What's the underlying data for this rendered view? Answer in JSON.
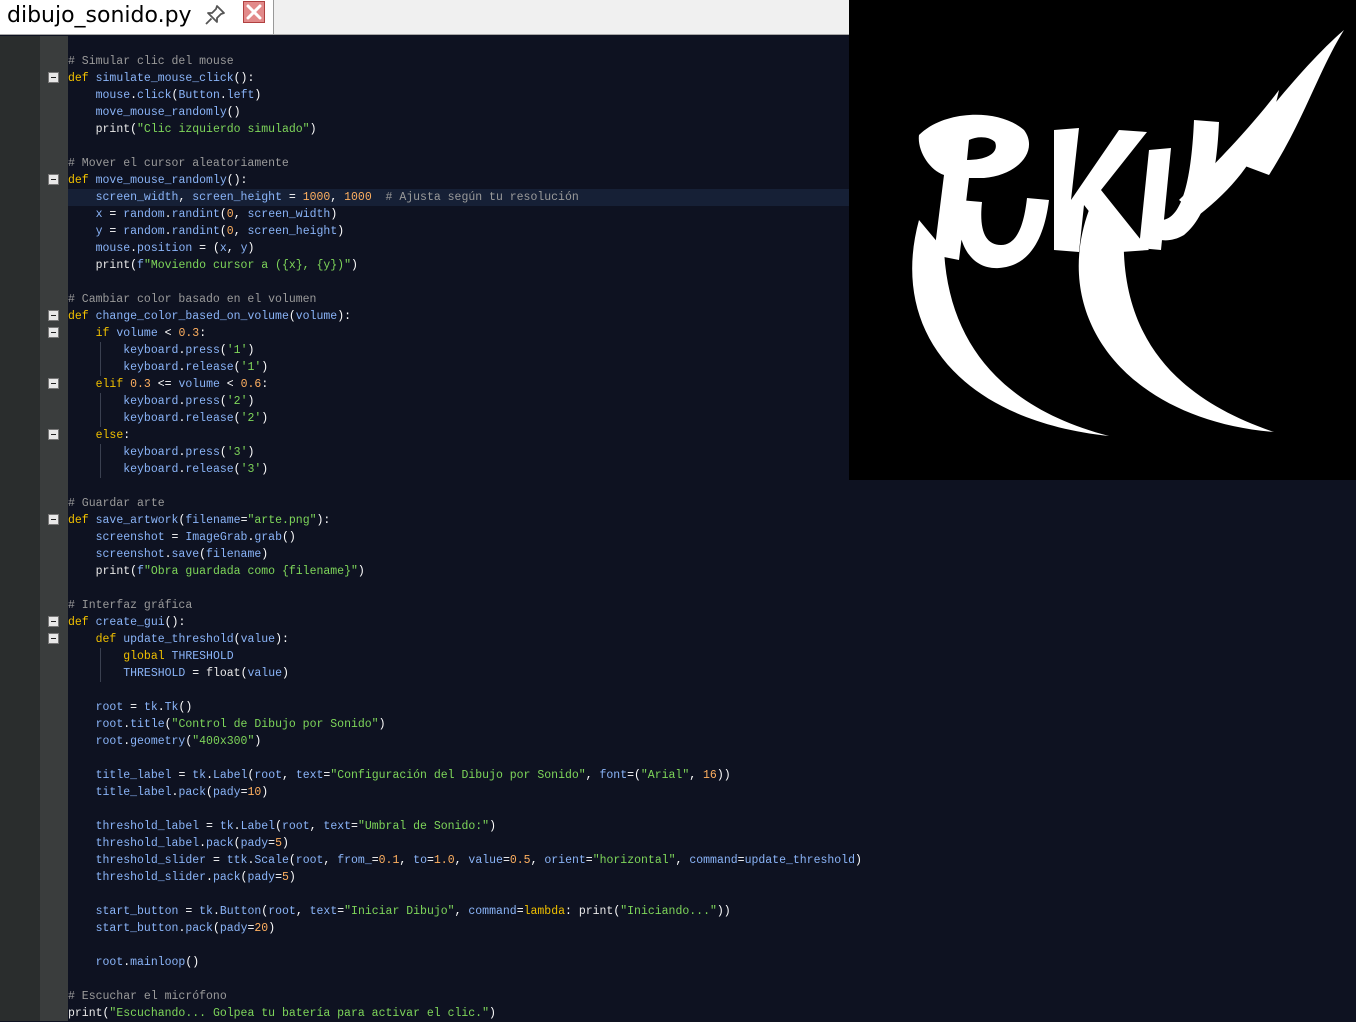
{
  "tab": {
    "filename": "dibujo_sonido.py"
  },
  "icons": {
    "pin": "pin-icon",
    "close": "close-icon"
  },
  "colors": {
    "editor_bg": "#0e1221",
    "comment": "#9a9a9a",
    "keyword": "#f0c000",
    "string": "#7ed65a",
    "number": "#ffb060",
    "variable": "#8ab4f8",
    "close_button": "#e28a8a"
  },
  "code": {
    "lines": [
      "# Simular clic del mouse",
      "def simulate_mouse_click():",
      "    mouse.click(Button.left)",
      "    move_mouse_randomly()",
      "    print(\"Clic izquierdo simulado\")",
      "",
      "# Mover el cursor aleatoriamente",
      "def move_mouse_randomly():",
      "    screen_width, screen_height = 1000, 1000  # Ajusta según tu resolución",
      "    x = random.randint(0, screen_width)",
      "    y = random.randint(0, screen_height)",
      "    mouse.position = (x, y)",
      "    print(f\"Moviendo cursor a ({x}, {y})\")",
      "",
      "# Cambiar color basado en el volumen",
      "def change_color_based_on_volume(volume):",
      "    if volume < 0.3:",
      "        keyboard.press('1')",
      "        keyboard.release('1')",
      "    elif 0.3 <= volume < 0.6:",
      "        keyboard.press('2')",
      "        keyboard.release('2')",
      "    else:",
      "        keyboard.press('3')",
      "        keyboard.release('3')",
      "",
      "# Guardar arte",
      "def save_artwork(filename=\"arte.png\"):",
      "    screenshot = ImageGrab.grab()",
      "    screenshot.save(filename)",
      "    print(f\"Obra guardada como {filename}\")",
      "",
      "# Interfaz gráfica",
      "def create_gui():",
      "    def update_threshold(value):",
      "        global THRESHOLD",
      "        THRESHOLD = float(value)",
      "",
      "    root = tk.Tk()",
      "    root.title(\"Control de Dibujo por Sonido\")",
      "    root.geometry(\"400x300\")",
      "",
      "    title_label = tk.Label(root, text=\"Configuración del Dibujo por Sonido\", font=(\"Arial\", 16))",
      "    title_label.pack(pady=10)",
      "",
      "    threshold_label = tk.Label(root, text=\"Umbral de Sonido:\")",
      "    threshold_label.pack(pady=5)",
      "    threshold_slider = ttk.Scale(root, from_=0.1, to=1.0, value=0.5, orient=\"horizontal\", command=update_threshold)",
      "    threshold_slider.pack(pady=5)",
      "",
      "    start_button = tk.Button(root, text=\"Iniciar Dibujo\", command=lambda: print(\"Iniciando...\"))",
      "    start_button.pack(pady=20)",
      "",
      "    root.mainloop()",
      "",
      "# Escuchar el micrófono",
      "print(\"Escuchando... Golpea tu batería para activar el clic.\")"
    ]
  }
}
